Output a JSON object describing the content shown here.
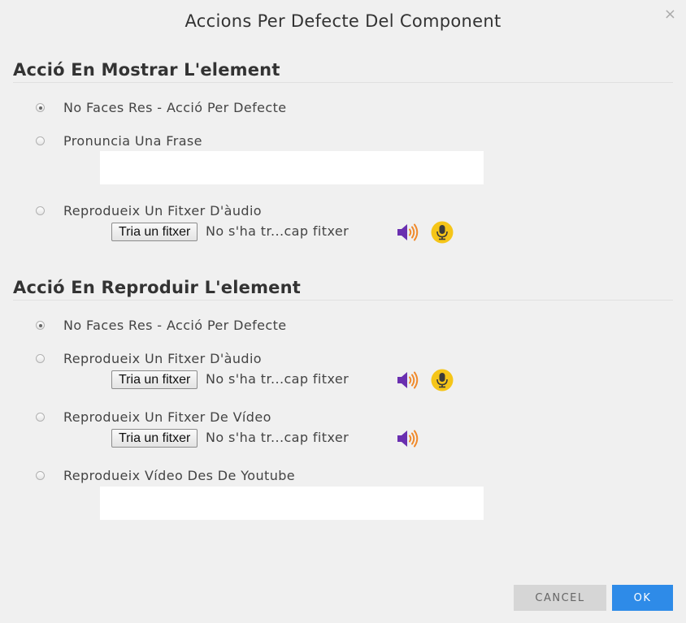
{
  "dialog": {
    "title": "Accions Per Defecte Del Component",
    "close_symbol": "×"
  },
  "section_show": {
    "heading": "Acció En Mostrar L'element",
    "options": [
      {
        "label": "No Faces Res - Acció Per Defecte",
        "checked": true
      },
      {
        "label": "Pronuncia Una Frase",
        "checked": false
      },
      {
        "label": "Reprodueix Un Fitxer D'àudio",
        "checked": false
      }
    ],
    "phrase_input": {
      "value": "",
      "placeholder": ""
    },
    "audio_file": {
      "button_label": "Tria un fitxer",
      "status": "No s'ha tr...cap fitxer"
    }
  },
  "section_play": {
    "heading": "Acció En Reproduir L'element",
    "options": [
      {
        "label": "No Faces Res - Acció Per Defecte",
        "checked": true
      },
      {
        "label": "Reprodueix Un Fitxer D'àudio",
        "checked": false
      },
      {
        "label": "Reprodueix Un Fitxer De Vídeo",
        "checked": false
      },
      {
        "label": "Reprodueix Vídeo Des De Youtube",
        "checked": false
      }
    ],
    "audio_file": {
      "button_label": "Tria un fitxer",
      "status": "No s'ha tr...cap fitxer"
    },
    "video_file": {
      "button_label": "Tria un fitxer",
      "status": "No s'ha tr...cap fitxer"
    },
    "youtube_input": {
      "value": "",
      "placeholder": ""
    }
  },
  "footer": {
    "cancel_label": "CANCEL",
    "ok_label": "OK"
  },
  "icons": {
    "speaker": "speaker-icon",
    "microphone": "microphone-icon"
  },
  "colors": {
    "speaker_purple": "#6a2fb0",
    "speaker_waves": "#f08a2c",
    "mic_yellow": "#f5c518",
    "ok_blue": "#2e8be8"
  }
}
